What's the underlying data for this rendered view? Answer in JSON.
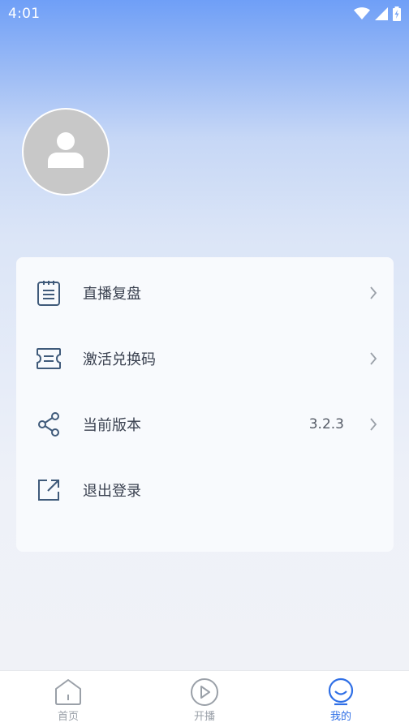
{
  "status_bar": {
    "time": "4:01"
  },
  "profile": {
    "avatar_icon": "user-placeholder-icon"
  },
  "menu": {
    "items": [
      {
        "label": "直播复盘",
        "value": "",
        "icon": "clipboard-list-icon",
        "has_chevron": true
      },
      {
        "label": "激活兑换码",
        "value": "",
        "icon": "ticket-icon",
        "has_chevron": true
      },
      {
        "label": "当前版本",
        "value": "3.2.3",
        "icon": "share-icon",
        "has_chevron": true
      },
      {
        "label": "退出登录",
        "value": "",
        "icon": "external-link-icon",
        "has_chevron": false
      }
    ]
  },
  "bottom_nav": {
    "items": [
      {
        "label": "首页",
        "icon": "home-icon",
        "active": false
      },
      {
        "label": "开播",
        "icon": "play-circle-icon",
        "active": false
      },
      {
        "label": "我的",
        "icon": "profile-face-icon",
        "active": true
      }
    ]
  },
  "colors": {
    "accent": "#2f6fe6",
    "header_gradient_top": "#6f9ff7",
    "menu_icon": "#3f5a7a",
    "inactive_nav": "#9aa0a8"
  }
}
